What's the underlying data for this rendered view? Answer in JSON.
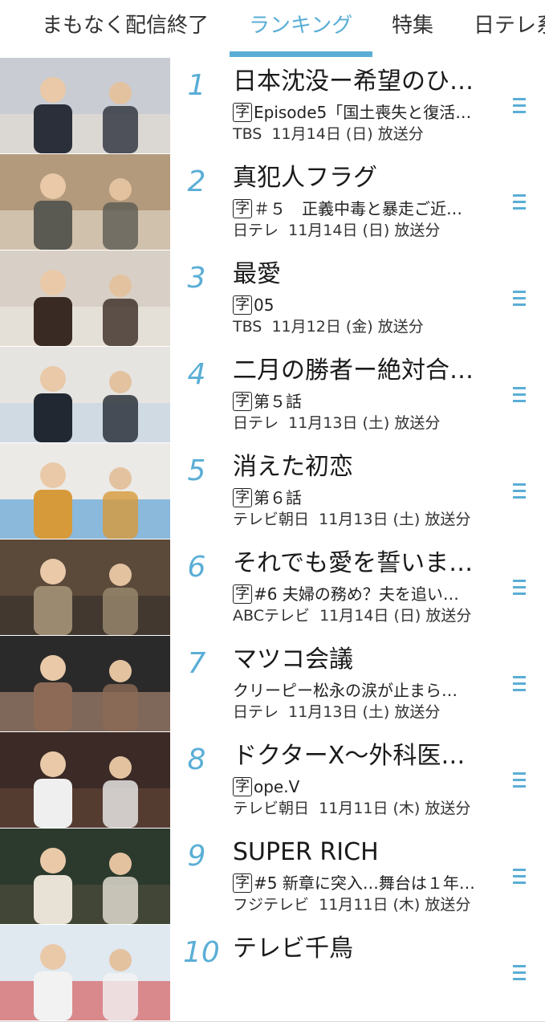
{
  "tabs": [
    {
      "label": "まもなく配信終了",
      "active": false
    },
    {
      "label": "ランキング",
      "active": true
    },
    {
      "label": "特集",
      "active": false
    },
    {
      "label": "日テレ系",
      "active": false
    }
  ],
  "colors": {
    "accent": "#5aaed6",
    "divider": "#d8d8d8"
  },
  "ranking": [
    {
      "rank": "1",
      "title": "日本沈没ー希望のひ…",
      "badge": "字",
      "subtitle": "Episode5「国土喪失と復活…",
      "network": "TBS",
      "date": "11月14日 (日) 放送分"
    },
    {
      "rank": "2",
      "title": "真犯人フラグ",
      "badge": "字",
      "subtitle": "＃５　正義中毒と暴走ご近…",
      "network": "日テレ",
      "date": "11月14日 (日) 放送分"
    },
    {
      "rank": "3",
      "title": "最愛",
      "badge": "字",
      "subtitle": "05",
      "network": "TBS",
      "date": "11月12日 (金) 放送分"
    },
    {
      "rank": "4",
      "title": "二月の勝者ー絶対合…",
      "badge": "字",
      "subtitle": "第５話",
      "network": "日テレ",
      "date": "11月13日 (土) 放送分"
    },
    {
      "rank": "5",
      "title": "消えた初恋",
      "badge": "字",
      "subtitle": "第６話",
      "network": "テレビ朝日",
      "date": "11月13日 (土) 放送分"
    },
    {
      "rank": "6",
      "title": "それでも愛を誓いま…",
      "badge": "字",
      "subtitle": "#6 夫婦の務め？夫を追い…",
      "network": "ABCテレビ",
      "date": "11月14日 (日) 放送分"
    },
    {
      "rank": "7",
      "title": "マツコ会議",
      "badge": "",
      "subtitle": "クリーピー松永の涙が止まら…",
      "network": "日テレ",
      "date": "11月13日 (土) 放送分"
    },
    {
      "rank": "8",
      "title": "ドクターX～外科医…",
      "badge": "字",
      "subtitle": "ope.V",
      "network": "テレビ朝日",
      "date": "11月11日 (木) 放送分"
    },
    {
      "rank": "9",
      "title": "SUPER RICH",
      "badge": "字",
      "subtitle": "#5 新章に突入…舞台は１年…",
      "network": "フジテレビ",
      "date": "11月11日 (木) 放送分"
    },
    {
      "rank": "10",
      "title": "テレビ千鳥",
      "badge": "",
      "subtitle": "",
      "network": "",
      "date": ""
    }
  ]
}
